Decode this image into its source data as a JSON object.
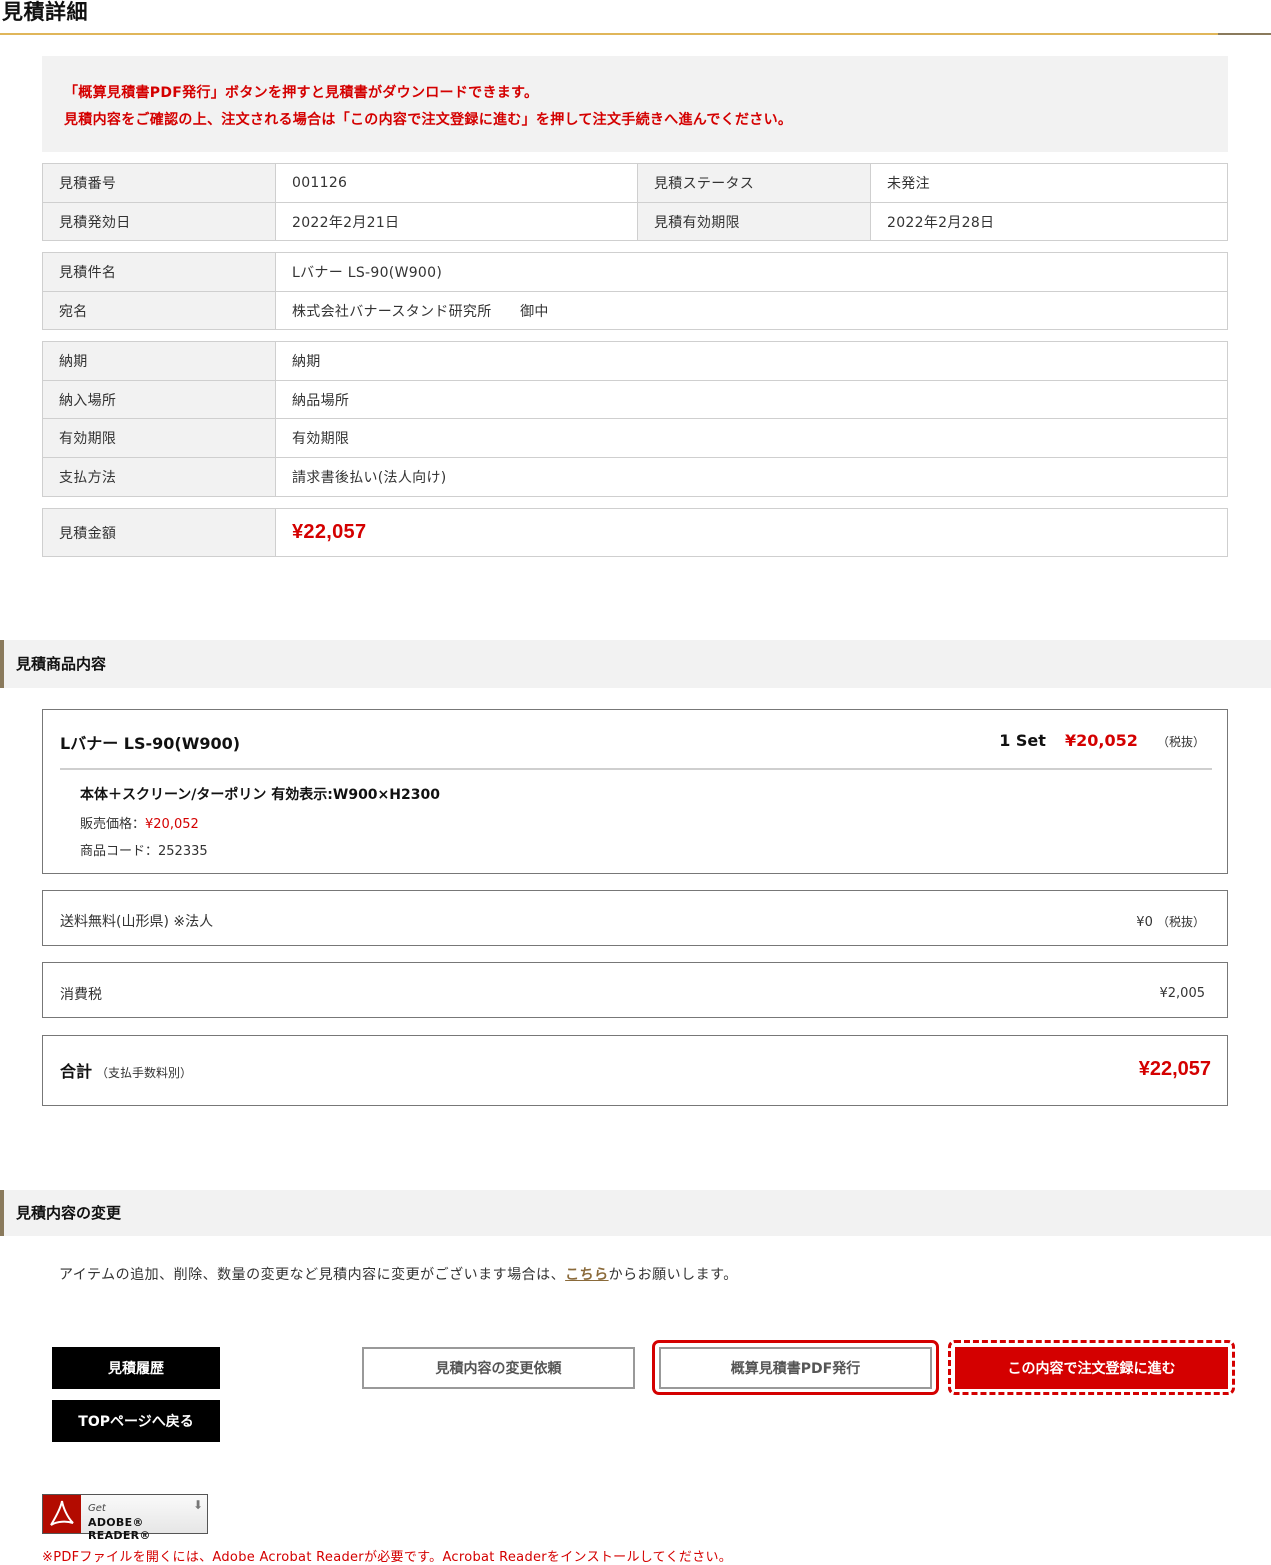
{
  "page_title": "見積詳細",
  "notice": {
    "line1": "「概算見積書PDF発行」ボタンを押すと見積書がダウンロードできます。",
    "line2": "見積内容をご確認の上、注文される場合は「この内容で注文登録に進む」を押して注文手続きへ進んでください。"
  },
  "info1": {
    "estimate_no_label": "見積番号",
    "estimate_no": "001126",
    "status_label": "見積ステータス",
    "status": "未発注",
    "issue_date_label": "見積発効日",
    "issue_date": "2022年2月21日",
    "expiry_label": "見積有効期限",
    "expiry": "2022年2月28日"
  },
  "info2": {
    "subject_label": "見積件名",
    "subject": "Lバナー LS-90(W900)",
    "addressee_label": "宛名",
    "addressee": "株式会社バナースタンド研究所　　御中"
  },
  "info3": {
    "delivery_label": "納期",
    "delivery": "納期",
    "place_label": "納入場所",
    "place": "納品場所",
    "valid_label": "有効期限",
    "valid": "有効期限",
    "payment_label": "支払方法",
    "payment": "請求書後払い(法人向け)"
  },
  "info4": {
    "amount_label": "見積金額",
    "amount": "¥22,057"
  },
  "items_section": {
    "title": "見積商品内容",
    "product": {
      "name": "Lバナー LS-90(W900)",
      "qty": "1 Set",
      "price": "¥20,052",
      "tax_note": "（税抜）",
      "desc": "本体＋スクリーン/ターポリン 有効表示:W900×H2300",
      "sale_label": "販売価格：",
      "sale_price": "¥20,052",
      "code": "商品コード：252335"
    },
    "shipping": {
      "label": "送料無料(山形県) ※法人",
      "value": "¥0",
      "tax_note": "（税抜）"
    },
    "tax": {
      "label": "消費税",
      "value": "¥2,005"
    },
    "total": {
      "label": "合計",
      "note": "（支払手数料別）",
      "value": "¥22,057"
    }
  },
  "change_section": {
    "title": "見積内容の変更",
    "text_before": "アイテムの追加、削除、数量の変更など見積内容に変更がございます場合は、",
    "link": "こちら",
    "text_after": "からお願いします。"
  },
  "buttons": {
    "history": "見積履歴",
    "top": "TOPページへ戻る",
    "change_request": "見積内容の変更依頼",
    "pdf": "概算見積書PDF発行",
    "order": "この内容で注文登録に進む"
  },
  "adobe": {
    "get": "Get",
    "reader": "ADOBE® READER®"
  },
  "pdf_note": "※PDFファイルを開くには、Adobe Acrobat Readerが必要です。Acrobat Readerをインストールしてください。",
  "colors": {
    "accent_red": "#d40000",
    "gold_rule": "#e0b65a",
    "brown": "#8a7a5c"
  }
}
